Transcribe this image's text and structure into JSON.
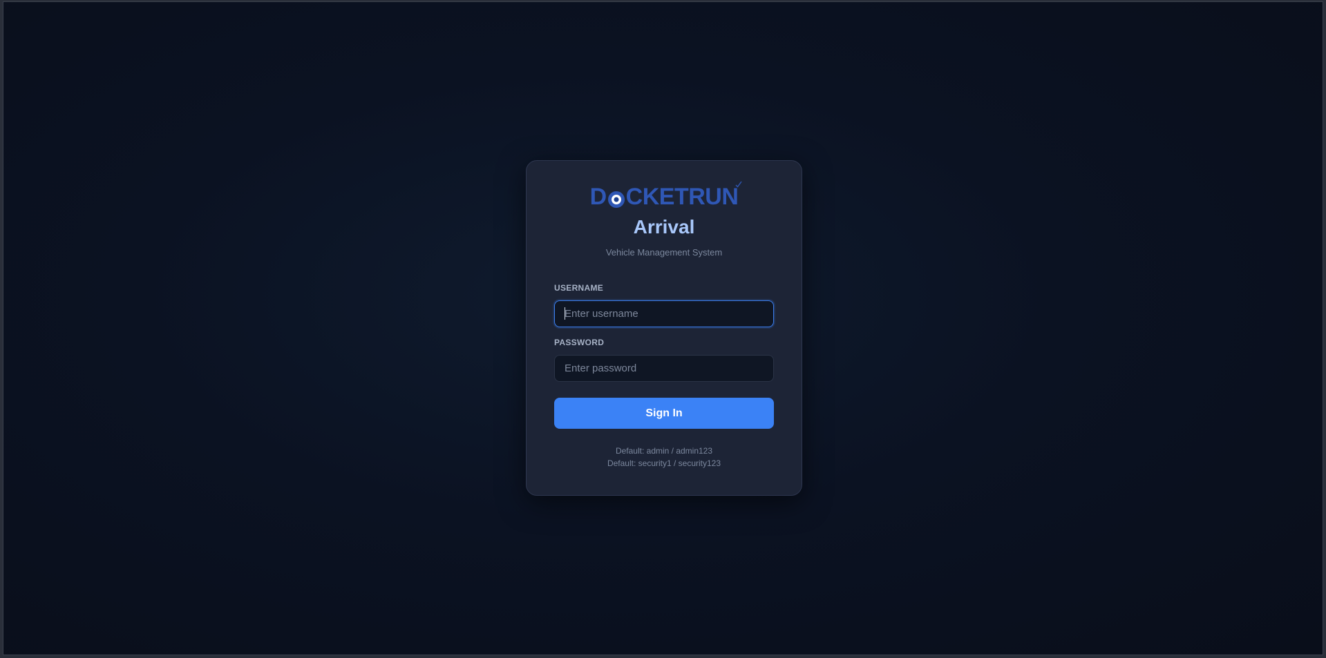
{
  "brand": {
    "logo_prefix": "D",
    "logo_suffix": "CKETRUN",
    "logo_icon": "eye-icon",
    "logo_color": "#2f57b5"
  },
  "header": {
    "title": "Arrival",
    "subtitle": "Vehicle Management System"
  },
  "form": {
    "username_label": "USERNAME",
    "username_placeholder": "Enter username",
    "username_value": "",
    "password_label": "PASSWORD",
    "password_placeholder": "Enter password",
    "password_value": "",
    "submit_label": "Sign In"
  },
  "hints": [
    "Default: admin / admin123",
    "Default: security1 / security123"
  ],
  "colors": {
    "accent": "#3b82f6",
    "title": "#a9c8fb",
    "card_bg": "#1d2436",
    "page_bg": "#0b1222"
  }
}
